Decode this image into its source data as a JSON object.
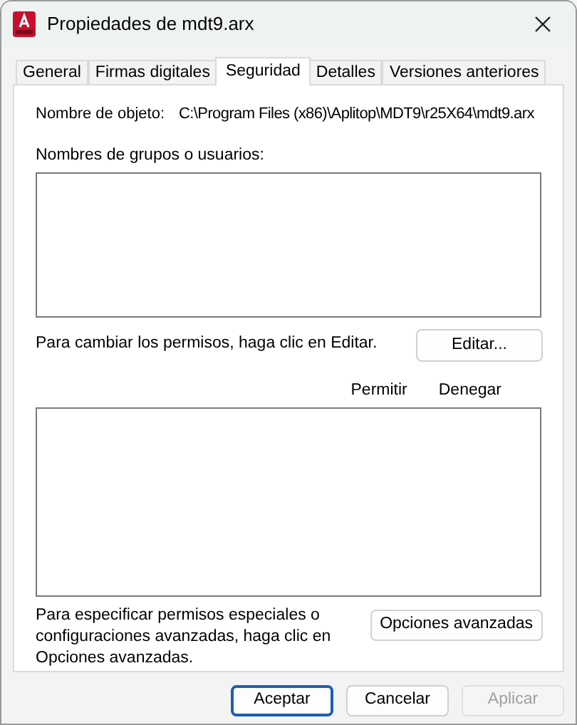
{
  "window": {
    "title": "Propiedades de mdt9.arx"
  },
  "tabs": [
    {
      "label": "General",
      "selected": false
    },
    {
      "label": "Firmas digitales",
      "selected": false
    },
    {
      "label": "Seguridad",
      "selected": true
    },
    {
      "label": "Detalles",
      "selected": false
    },
    {
      "label": "Versiones anteriores",
      "selected": false
    }
  ],
  "object_name": {
    "label": "Nombre de objeto:",
    "value": "C:\\Program Files (x86)\\Aplitop\\MDT9\\r25X64\\mdt9.arx"
  },
  "groups_label": "Nombres de grupos o usuarios:",
  "change_hint": "Para cambiar los permisos, haga clic en Editar.",
  "edit_button": "Editar...",
  "permission_columns": [
    "Permitir",
    "Denegar"
  ],
  "advanced_hint": "Para especificar permisos especiales o configuraciones avanzadas, haga clic en Opciones avanzadas.",
  "advanced_button": "Opciones avanzadas",
  "buttons": [
    {
      "label": "Aceptar",
      "kind": "default",
      "disabled": false
    },
    {
      "label": "Cancelar",
      "kind": "normal",
      "disabled": false
    },
    {
      "label": "Aplicar",
      "kind": "normal",
      "disabled": true
    }
  ]
}
